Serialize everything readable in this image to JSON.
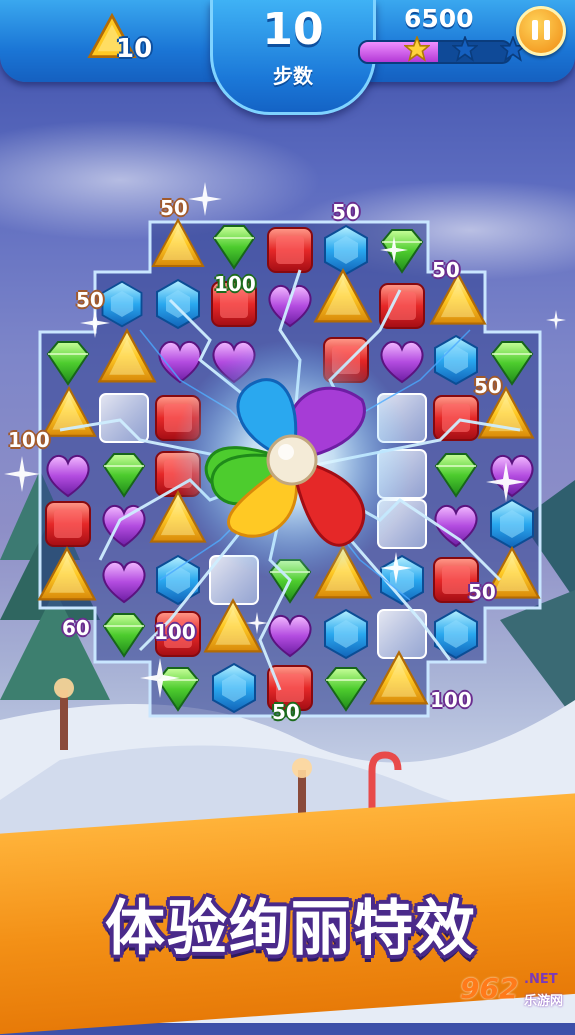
{
  "hud": {
    "target_icon": "yellow-triangle-gem-icon",
    "target_count": "10",
    "moves_value": "10",
    "moves_label": "步数",
    "score": "6500",
    "progress_fraction": 0.52,
    "progress_stars_earned": 1,
    "progress_stars_total": 3,
    "pause_icon": "pause-icon"
  },
  "board": {
    "special_effect_icon": "pinwheel-bomb-icon",
    "gem_types": [
      "yellow-triangle",
      "green-diamond",
      "red-square",
      "blue-hexagon",
      "purple-heart",
      "ice-block"
    ],
    "score_popups": [
      "50",
      "50",
      "50",
      "100",
      "50",
      "50",
      "100",
      "50",
      "60",
      "100",
      "50",
      "100"
    ]
  },
  "banner": {
    "text": "体验绚丽特效"
  },
  "watermark": {
    "number": "962",
    "net": ".NET",
    "site": "乐游网"
  },
  "colors": {
    "hud_blue": "#1b76d6",
    "banner_orange": "#f39016",
    "score_outline_purple": "#6a2d8f",
    "progress_purple": "#b339d6",
    "pause_orange": "#f08a12"
  }
}
